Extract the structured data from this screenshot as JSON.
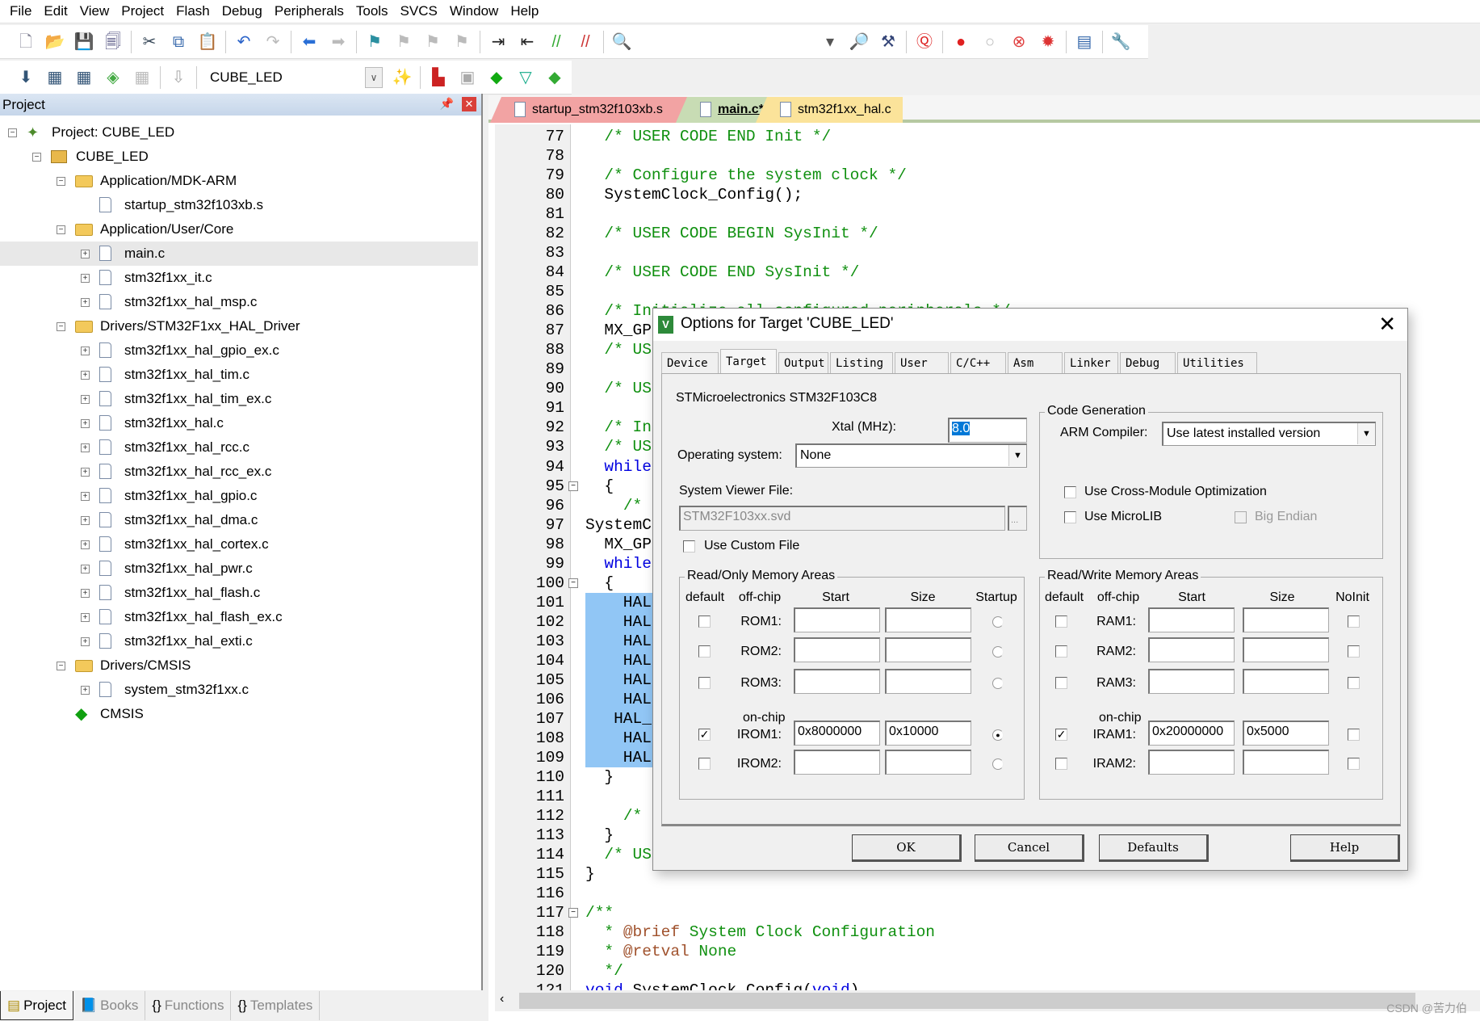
{
  "menu": [
    "File",
    "Edit",
    "View",
    "Project",
    "Flash",
    "Debug",
    "Peripherals",
    "Tools",
    "SVCS",
    "Window",
    "Help"
  ],
  "toolbar1": [
    {
      "icon": "new-file-icon",
      "g": "🗋",
      "c": "#889"
    },
    {
      "icon": "open-folder-icon",
      "g": "📂",
      "c": "#c90"
    },
    {
      "icon": "save-icon",
      "g": "💾",
      "c": "#336"
    },
    {
      "icon": "save-all-icon",
      "g": "🗐",
      "c": "#447"
    },
    {
      "sep": true
    },
    {
      "icon": "cut-icon",
      "g": "✂",
      "c": "#345"
    },
    {
      "icon": "copy-icon",
      "g": "⧉",
      "c": "#36a"
    },
    {
      "icon": "paste-icon",
      "g": "📋",
      "c": "#a80"
    },
    {
      "sep": true
    },
    {
      "icon": "undo-icon",
      "g": "↶",
      "c": "#2a63c9"
    },
    {
      "icon": "redo-icon",
      "g": "↷",
      "c": "#bbb"
    },
    {
      "sep": true
    },
    {
      "icon": "navigate-back-icon",
      "g": "⬅",
      "c": "#2a6fd6"
    },
    {
      "icon": "navigate-forward-icon",
      "g": "➡",
      "c": "#bbb"
    },
    {
      "sep": true
    },
    {
      "icon": "bookmark-icon",
      "g": "⚑",
      "c": "#2a8fa0"
    },
    {
      "icon": "prev-bookmark-icon",
      "g": "⚑",
      "c": "#bbb"
    },
    {
      "icon": "next-bookmark-icon",
      "g": "⚑",
      "c": "#bbb"
    },
    {
      "icon": "clear-bookmarks-icon",
      "g": "⚑",
      "c": "#bbb"
    },
    {
      "sep": true
    },
    {
      "icon": "indent-icon",
      "g": "⇥",
      "c": "#222"
    },
    {
      "icon": "unindent-icon",
      "g": "⇤",
      "c": "#222"
    },
    {
      "icon": "comment-icon",
      "g": "//",
      "c": "#3a3"
    },
    {
      "icon": "uncomment-icon",
      "g": "//",
      "c": "#c33"
    },
    {
      "sep": true
    },
    {
      "icon": "find-in-files-icon",
      "g": "🔍",
      "c": "#a80"
    },
    {
      "gap": true
    },
    {
      "icon": "find-dropdown-icon",
      "g": "▾",
      "c": "#555"
    },
    {
      "icon": "incremental-find-icon",
      "g": "🔎",
      "c": "#347"
    },
    {
      "icon": "debug-session-icon",
      "g": "⚒",
      "c": "#347"
    },
    {
      "sep": true
    },
    {
      "icon": "start-debug-icon",
      "g": "Ⓠ",
      "c": "#d22"
    },
    {
      "sep": true
    },
    {
      "icon": "breakpoint-icon",
      "g": "●",
      "c": "#e02020"
    },
    {
      "icon": "disable-breakpoint-icon",
      "g": "○",
      "c": "#bbb"
    },
    {
      "icon": "disable-all-breakpoints-icon",
      "g": "⊗",
      "c": "#e04040"
    },
    {
      "icon": "kill-all-breakpoints-icon",
      "g": "✹",
      "c": "#d33"
    },
    {
      "sep": true
    },
    {
      "icon": "window-layout-icon",
      "g": "▤",
      "c": "#36a"
    },
    {
      "sep": true
    },
    {
      "icon": "configure-icon",
      "g": "🔧",
      "c": "#357"
    }
  ],
  "toolbar2": [
    {
      "icon": "translate-icon",
      "g": "⬇",
      "c": "#357"
    },
    {
      "icon": "build-icon",
      "g": "▦",
      "c": "#357"
    },
    {
      "icon": "rebuild-icon",
      "g": "▦",
      "c": "#357"
    },
    {
      "icon": "batch-build-icon",
      "g": "◈",
      "c": "#4a4"
    },
    {
      "icon": "stop-build-icon",
      "g": "▦",
      "c": "#bbb"
    },
    {
      "sep": true
    },
    {
      "icon": "download-icon",
      "g": "⇩",
      "c": "#aaa"
    },
    {
      "sep": true
    },
    {
      "target": true
    },
    {
      "icon": "options-for-target-icon",
      "g": "✨",
      "c": "#357"
    },
    {
      "sep": true
    },
    {
      "icon": "manage-project-items-icon",
      "g": "▙",
      "c": "#c22"
    },
    {
      "icon": "select-packs-icon",
      "g": "▣",
      "c": "#aaa"
    },
    {
      "icon": "manage-rte-icon",
      "g": "◆",
      "c": "#1a1"
    },
    {
      "icon": "select-software-packs-icon",
      "g": "▽",
      "c": "#1a8"
    },
    {
      "icon": "pack-installer-icon",
      "g": "◆",
      "c": "#3a3"
    }
  ],
  "target_select": "CUBE_LED",
  "project_panel": {
    "title": "Project",
    "tree": [
      {
        "label": "Project: CUBE_LED",
        "level": 0,
        "exp": "−",
        "icon": "project"
      },
      {
        "label": "CUBE_LED",
        "level": 1,
        "exp": "−",
        "icon": "target"
      },
      {
        "label": "Application/MDK-ARM",
        "level": 2,
        "exp": "−",
        "icon": "folder"
      },
      {
        "label": "startup_stm32f103xb.s",
        "level": 3,
        "exp": "",
        "icon": "file"
      },
      {
        "label": "Application/User/Core",
        "level": 2,
        "exp": "−",
        "icon": "folder"
      },
      {
        "label": "main.c",
        "level": 3,
        "exp": "+",
        "icon": "file",
        "selected": true
      },
      {
        "label": "stm32f1xx_it.c",
        "level": 3,
        "exp": "+",
        "icon": "file"
      },
      {
        "label": "stm32f1xx_hal_msp.c",
        "level": 3,
        "exp": "+",
        "icon": "file"
      },
      {
        "label": "Drivers/STM32F1xx_HAL_Driver",
        "level": 2,
        "exp": "−",
        "icon": "folder"
      },
      {
        "label": "stm32f1xx_hal_gpio_ex.c",
        "level": 3,
        "exp": "+",
        "icon": "file"
      },
      {
        "label": "stm32f1xx_hal_tim.c",
        "level": 3,
        "exp": "+",
        "icon": "file"
      },
      {
        "label": "stm32f1xx_hal_tim_ex.c",
        "level": 3,
        "exp": "+",
        "icon": "file"
      },
      {
        "label": "stm32f1xx_hal.c",
        "level": 3,
        "exp": "+",
        "icon": "file"
      },
      {
        "label": "stm32f1xx_hal_rcc.c",
        "level": 3,
        "exp": "+",
        "icon": "file"
      },
      {
        "label": "stm32f1xx_hal_rcc_ex.c",
        "level": 3,
        "exp": "+",
        "icon": "file"
      },
      {
        "label": "stm32f1xx_hal_gpio.c",
        "level": 3,
        "exp": "+",
        "icon": "file"
      },
      {
        "label": "stm32f1xx_hal_dma.c",
        "level": 3,
        "exp": "+",
        "icon": "file"
      },
      {
        "label": "stm32f1xx_hal_cortex.c",
        "level": 3,
        "exp": "+",
        "icon": "file"
      },
      {
        "label": "stm32f1xx_hal_pwr.c",
        "level": 3,
        "exp": "+",
        "icon": "file"
      },
      {
        "label": "stm32f1xx_hal_flash.c",
        "level": 3,
        "exp": "+",
        "icon": "file"
      },
      {
        "label": "stm32f1xx_hal_flash_ex.c",
        "level": 3,
        "exp": "+",
        "icon": "file"
      },
      {
        "label": "stm32f1xx_hal_exti.c",
        "level": 3,
        "exp": "+",
        "icon": "file"
      },
      {
        "label": "Drivers/CMSIS",
        "level": 2,
        "exp": "−",
        "icon": "folder"
      },
      {
        "label": "system_stm32f1xx.c",
        "level": 3,
        "exp": "+",
        "icon": "file"
      },
      {
        "label": "CMSIS",
        "level": 2,
        "exp": "",
        "icon": "component"
      }
    ],
    "bottom_tabs": [
      {
        "label": "Project",
        "icon": "project-tab-icon",
        "g": "▤",
        "active": true
      },
      {
        "label": "Books",
        "icon": "books-icon",
        "g": "📘"
      },
      {
        "label": "Functions",
        "icon": "functions-icon",
        "g": "{}"
      },
      {
        "label": "Templates",
        "icon": "templates-icon",
        "g": "{}"
      }
    ]
  },
  "editor": {
    "tabs": [
      {
        "label": "startup_stm32f103xb.s",
        "color": "#f2a3a3"
      },
      {
        "label": "main.c*",
        "color": "#c8dcb4",
        "active": true
      },
      {
        "label": "stm32f1xx_hal.c",
        "color": "#fbe39a"
      }
    ],
    "lines": [
      {
        "n": "77",
        "segs": [
          [
            "  ",
            "plain"
          ],
          [
            "/* USER CODE END Init */",
            "comment"
          ]
        ]
      },
      {
        "n": "78",
        "segs": []
      },
      {
        "n": "79",
        "segs": [
          [
            "  ",
            "plain"
          ],
          [
            "/* Configure the system clock */",
            "comment"
          ]
        ]
      },
      {
        "n": "80",
        "segs": [
          [
            "  SystemClock_Config();",
            "plain"
          ]
        ]
      },
      {
        "n": "81",
        "segs": []
      },
      {
        "n": "82",
        "segs": [
          [
            "  ",
            "plain"
          ],
          [
            "/* USER CODE BEGIN SysInit */",
            "comment"
          ]
        ]
      },
      {
        "n": "83",
        "segs": []
      },
      {
        "n": "84",
        "segs": [
          [
            "  ",
            "plain"
          ],
          [
            "/* USER CODE END SysInit */",
            "comment"
          ]
        ]
      },
      {
        "n": "85",
        "segs": []
      },
      {
        "n": "86",
        "segs": [
          [
            "  ",
            "plain"
          ],
          [
            "/* Initialize all configured peripherals */",
            "comment"
          ]
        ]
      },
      {
        "n": "87",
        "segs": [
          [
            "  MX_GP",
            "plain"
          ]
        ]
      },
      {
        "n": "88",
        "segs": [
          [
            "  ",
            "plain"
          ],
          [
            "/* US",
            "comment"
          ]
        ]
      },
      {
        "n": "89",
        "segs": []
      },
      {
        "n": "90",
        "segs": [
          [
            "  ",
            "plain"
          ],
          [
            "/* US",
            "comment"
          ]
        ]
      },
      {
        "n": "91",
        "segs": []
      },
      {
        "n": "92",
        "segs": [
          [
            "  ",
            "plain"
          ],
          [
            "/* In",
            "comment"
          ]
        ]
      },
      {
        "n": "93",
        "segs": [
          [
            "  ",
            "plain"
          ],
          [
            "/* US",
            "comment"
          ]
        ]
      },
      {
        "n": "94",
        "segs": [
          [
            "  ",
            "plain"
          ],
          [
            "while",
            "kw"
          ]
        ]
      },
      {
        "n": "95",
        "segs": [
          [
            "  {",
            "plain"
          ]
        ],
        "fold": "−"
      },
      {
        "n": "96",
        "segs": [
          [
            "    ",
            "plain"
          ],
          [
            "/*",
            "comment"
          ]
        ]
      },
      {
        "n": "97",
        "segs": [
          [
            "SystemC",
            "plain"
          ]
        ]
      },
      {
        "n": "98",
        "segs": [
          [
            "  MX_GP",
            "plain"
          ]
        ]
      },
      {
        "n": "99",
        "segs": [
          [
            "  ",
            "plain"
          ],
          [
            "while",
            "kw"
          ]
        ]
      },
      {
        "n": "100",
        "segs": [
          [
            "  {",
            "plain"
          ]
        ],
        "fold": "−"
      },
      {
        "n": "101",
        "segs": [
          [
            "    HAL",
            "plain"
          ]
        ],
        "hl": true
      },
      {
        "n": "102",
        "segs": [
          [
            "    HAL",
            "plain"
          ]
        ],
        "hl": true
      },
      {
        "n": "103",
        "segs": [
          [
            "    HAL",
            "plain"
          ]
        ],
        "hl": true
      },
      {
        "n": "104",
        "segs": [
          [
            "    HAL",
            "plain"
          ]
        ],
        "hl": true
      },
      {
        "n": "105",
        "segs": [
          [
            "    HAL",
            "plain"
          ]
        ],
        "hl": true
      },
      {
        "n": "106",
        "segs": [
          [
            "    HAL",
            "plain"
          ]
        ],
        "hl": true
      },
      {
        "n": "107",
        "segs": [
          [
            "   HAL_",
            "plain"
          ]
        ],
        "hl": true
      },
      {
        "n": "108",
        "segs": [
          [
            "    HAL",
            "plain"
          ]
        ],
        "hl": true
      },
      {
        "n": "109",
        "segs": [
          [
            "    HAL",
            "plain"
          ]
        ],
        "hl": true
      },
      {
        "n": "110",
        "segs": [
          [
            "  }",
            "plain"
          ]
        ]
      },
      {
        "n": "111",
        "segs": []
      },
      {
        "n": "112",
        "segs": [
          [
            "    ",
            "plain"
          ],
          [
            "/*",
            "comment"
          ]
        ]
      },
      {
        "n": "113",
        "segs": [
          [
            "  }",
            "plain"
          ]
        ]
      },
      {
        "n": "114",
        "segs": [
          [
            "  ",
            "plain"
          ],
          [
            "/* US",
            "comment"
          ]
        ]
      },
      {
        "n": "115",
        "segs": [
          [
            "}",
            "plain"
          ]
        ]
      },
      {
        "n": "116",
        "segs": []
      },
      {
        "n": "117",
        "segs": [
          [
            "/**",
            "comment"
          ]
        ],
        "fold": "−"
      },
      {
        "n": "118",
        "segs": [
          [
            "  * ",
            "comment"
          ],
          [
            "@brief",
            "tag"
          ],
          [
            " System Clock Configuration",
            "comment"
          ]
        ]
      },
      {
        "n": "119",
        "segs": [
          [
            "  * ",
            "comment"
          ],
          [
            "@retval",
            "tag"
          ],
          [
            " None",
            "comment"
          ]
        ]
      },
      {
        "n": "120",
        "segs": [
          [
            "  */",
            "comment"
          ]
        ]
      },
      {
        "n": "121",
        "segs": [
          [
            "void",
            "kw"
          ],
          [
            " SystemClock_Config(",
            "plain"
          ],
          [
            "void",
            "kw"
          ],
          [
            ")",
            "plain"
          ]
        ]
      }
    ]
  },
  "dialog": {
    "title": "Options for Target 'CUBE_LED'",
    "tabs": [
      "Device",
      "Target",
      "Output",
      "Listing",
      "User",
      "C/C++",
      "Asm",
      "Linker",
      "Debug",
      "Utilities"
    ],
    "active_tab": "Target",
    "device": "STMicroelectronics STM32F103C8",
    "xtal_label": "Xtal (MHz):",
    "xtal_value": "8.0",
    "os_label": "Operating system:",
    "os_value": "None",
    "svd_label": "System Viewer File:",
    "svd_value": "STM32F103xx.svd",
    "browse_label": "...",
    "use_custom_file": {
      "label": "Use Custom File",
      "checked": false
    },
    "code_gen": {
      "title": "Code Generation",
      "compiler_label": "ARM Compiler:",
      "compiler_value": "Use latest installed version",
      "cross_module": {
        "label": "Use Cross-Module Optimization",
        "checked": false
      },
      "microlib": {
        "label": "Use MicroLIB",
        "checked": false
      },
      "big_endian": {
        "label": "Big Endian",
        "checked": false,
        "disabled": true
      }
    },
    "ro": {
      "title": "Read/Only Memory Areas",
      "headers": [
        "default",
        "off-chip",
        "Start",
        "Size",
        "Startup"
      ],
      "onchip_label": "on-chip",
      "rows": [
        {
          "label": "ROM1:",
          "default": false,
          "start": "",
          "size": "",
          "startup": false
        },
        {
          "label": "ROM2:",
          "default": false,
          "start": "",
          "size": "",
          "startup": false
        },
        {
          "label": "ROM3:",
          "default": false,
          "start": "",
          "size": "",
          "startup": false
        },
        {
          "label": "IROM1:",
          "default": true,
          "start": "0x8000000",
          "size": "0x10000",
          "startup": true
        },
        {
          "label": "IROM2:",
          "default": false,
          "start": "",
          "size": "",
          "startup": false
        }
      ]
    },
    "rw": {
      "title": "Read/Write Memory Areas",
      "headers": [
        "default",
        "off-chip",
        "Start",
        "Size",
        "NoInit"
      ],
      "onchip_label": "on-chip",
      "rows": [
        {
          "label": "RAM1:",
          "default": false,
          "start": "",
          "size": "",
          "noinit": false
        },
        {
          "label": "RAM2:",
          "default": false,
          "start": "",
          "size": "",
          "noinit": false
        },
        {
          "label": "RAM3:",
          "default": false,
          "start": "",
          "size": "",
          "noinit": false
        },
        {
          "label": "IRAM1:",
          "default": true,
          "start": "0x20000000",
          "size": "0x5000",
          "noinit": false
        },
        {
          "label": "IRAM2:",
          "default": false,
          "start": "",
          "size": "",
          "noinit": false
        }
      ]
    },
    "buttons": {
      "ok": "OK",
      "cancel": "Cancel",
      "defaults": "Defaults",
      "help": "Help"
    }
  },
  "watermark": "CSDN @苦力伯"
}
